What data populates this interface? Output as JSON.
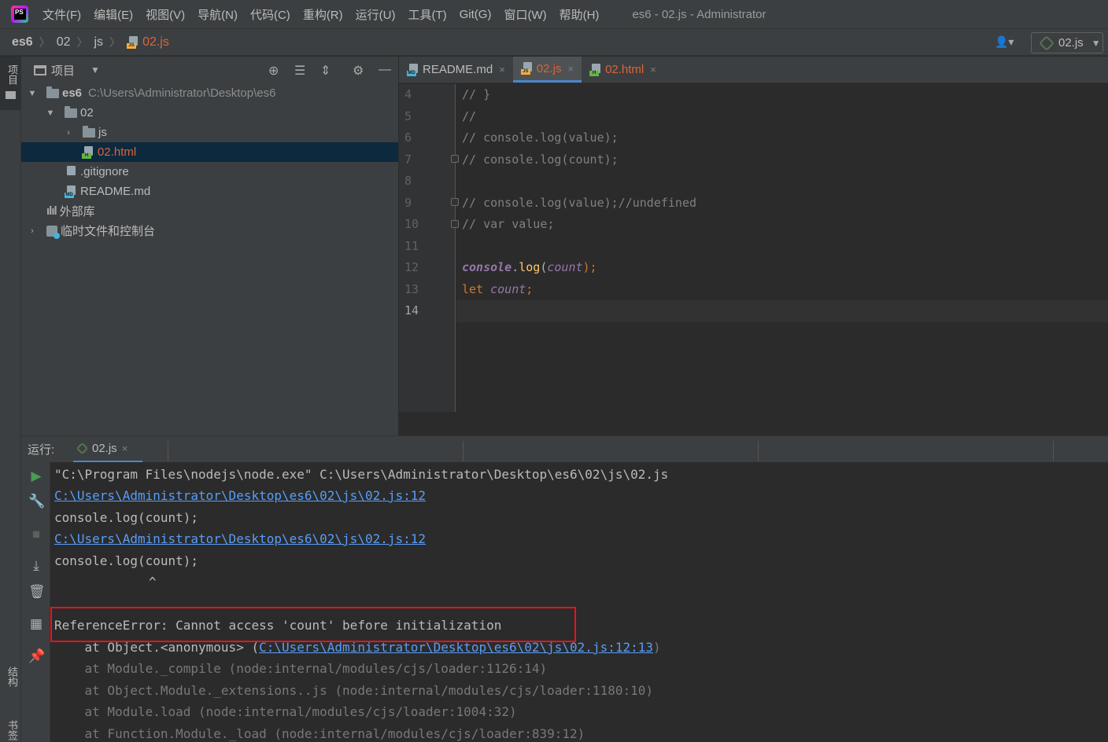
{
  "menubar": {
    "items": [
      "文件(F)",
      "编辑(E)",
      "视图(V)",
      "导航(N)",
      "代码(C)",
      "重构(R)",
      "运行(U)",
      "工具(T)",
      "Git(G)",
      "窗口(W)",
      "帮助(H)"
    ],
    "window_title": "es6 - 02.js - Administrator"
  },
  "breadcrumb": {
    "root": "es6",
    "folder": "02",
    "subfolder": "js",
    "file": "02.js",
    "run_config": "02.js"
  },
  "left_stripe": {
    "project": "项目",
    "structure": "结构",
    "bookmarks": "书签"
  },
  "project_panel": {
    "title": "项目",
    "tree": {
      "root_name": "es6",
      "root_path": "C:\\Users\\Administrator\\Desktop\\es6",
      "folder_02": "02",
      "folder_js": "js",
      "file_html": "02.html",
      "file_gitignore": ".gitignore",
      "file_readme": "README.md",
      "external_libs": "外部库",
      "scratches": "临时文件和控制台"
    }
  },
  "editor": {
    "tabs": [
      {
        "label": "README.md",
        "close": "×"
      },
      {
        "label": "02.js",
        "close": "×"
      },
      {
        "label": "02.html",
        "close": "×"
      }
    ],
    "line_numbers": [
      "4",
      "5",
      "6",
      "7",
      "8",
      "9",
      "10",
      "11",
      "12",
      "13",
      "14"
    ],
    "code": {
      "l4": "// }",
      "l5": "//",
      "l6": "// console.log(value);",
      "l7": "// console.log(count);",
      "l9": "// console.log(value);//undefined",
      "l10": "// var value;",
      "l12_obj": "console",
      "l12_dot": ".",
      "l12_fn": "log",
      "l12_open": "(",
      "l12_var": "count",
      "l12_close": ");",
      "l13_kw": "let",
      "l13_var": "count",
      "l13_semi": ";"
    }
  },
  "run_panel": {
    "label": "运行:",
    "tab": "02.js",
    "tab_close": "×",
    "console": {
      "cmd": "\"C:\\Program Files\\nodejs\\node.exe\" C:\\Users\\Administrator\\Desktop\\es6\\02\\js\\02.js",
      "link1": "C:\\Users\\Administrator\\Desktop\\es6\\02\\js\\02.js:12",
      "src1": "console.log(count);",
      "link2": "C:\\Users\\Administrator\\Desktop\\es6\\02\\js\\02.js:12",
      "src2": "console.log(count);",
      "caret": "^",
      "error": "ReferenceError: Cannot access 'count' before initialization",
      "stack1_prefix": "    at Object.<anonymous> (",
      "stack1_link": "C:\\Users\\Administrator\\Desktop\\es6\\02\\js\\02.js:12:13",
      "stack1_suffix": ")",
      "stack2": "    at Module._compile (node:internal/modules/cjs/loader:1126:14)",
      "stack3": "    at Object.Module._extensions..js (node:internal/modules/cjs/loader:1180:10)",
      "stack4": "    at Module.load (node:internal/modules/cjs/loader:1004:32)",
      "stack5": "    at Function.Module._load (node:internal/modules/cjs/loader:839:12)"
    }
  },
  "colors": {
    "accent": "#4a88c7",
    "error_box": "#e8121b",
    "link": "#589df6",
    "active_file": "#d9653b"
  }
}
